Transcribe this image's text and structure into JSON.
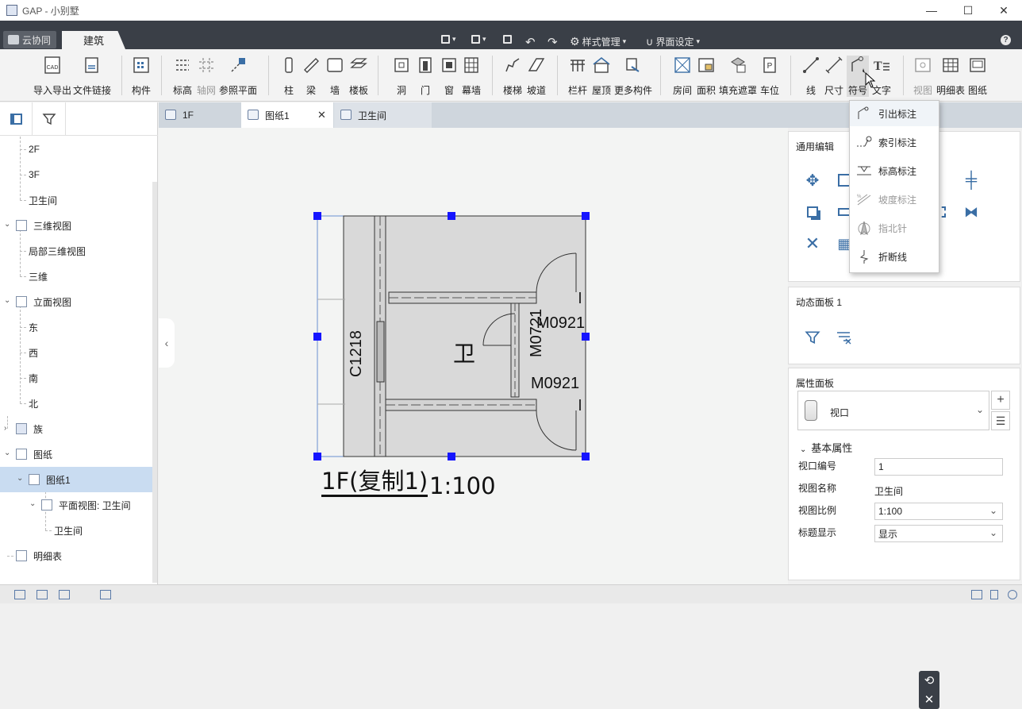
{
  "window": {
    "title": "GAP - 小别墅",
    "minimize": "—",
    "maximize": "☐",
    "close": "✕"
  },
  "top_tabs": {
    "cloud": "云协同",
    "building": "建筑"
  },
  "quick_access": {
    "style_manage": "样式管理",
    "ui_settings": "界面设定",
    "help": "?"
  },
  "ribbon": {
    "import_export": "导入导出",
    "file_link": "文件链接",
    "component": "构件",
    "level": "标高",
    "grid": "轴网",
    "ref_plane": "参照平面",
    "column": "柱",
    "beam": "梁",
    "wall": "墙",
    "slab": "楼板",
    "opening": "洞",
    "door": "门",
    "window": "窗",
    "curtain_wall": "幕墙",
    "stair": "楼梯",
    "ramp": "坡道",
    "railing": "栏杆",
    "roof": "屋顶",
    "more": "更多构件",
    "room": "房间",
    "area": "面积",
    "fill_mask": "填充遮罩",
    "parking": "车位",
    "line": "线",
    "dimension": "尺寸",
    "symbol": "符号",
    "text": "文字",
    "view": "视图",
    "schedule": "明细表",
    "sheet": "图纸"
  },
  "symbol_menu": [
    {
      "label": "引出标注",
      "icon": "leader-note-icon",
      "enabled": true
    },
    {
      "label": "索引标注",
      "icon": "index-note-icon",
      "enabled": true
    },
    {
      "label": "标高标注",
      "icon": "elevation-note-icon",
      "enabled": true
    },
    {
      "label": "坡度标注",
      "icon": "slope-note-icon",
      "enabled": false
    },
    {
      "label": "指北针",
      "icon": "north-arrow-icon",
      "enabled": false
    },
    {
      "label": "折断线",
      "icon": "break-line-icon",
      "enabled": true
    }
  ],
  "tree": {
    "n_2f": "2F",
    "n_3f": "3F",
    "n_bath": "卫生间",
    "n_3dviews": "三维视图",
    "n_local3d": "局部三维视图",
    "n_3d": "三维",
    "n_elev": "立面视图",
    "n_east": "东",
    "n_west": "西",
    "n_south": "南",
    "n_north": "北",
    "n_family": "族",
    "n_sheets": "图纸",
    "n_sheet1": "图纸1",
    "n_planview": "平面视图: 卫生间",
    "n_bath2": "卫生间",
    "n_schedule": "明细表"
  },
  "doc_tabs": {
    "t1": "1F",
    "t2": "图纸1",
    "t3": "卫生间",
    "close": "✕"
  },
  "drawing": {
    "c1218": "C1218",
    "m0721": "M0721",
    "m0921a": "M0921",
    "m0921b": "M0921",
    "room": "卫",
    "view_title": "1F(复制1)",
    "scale": "1:100"
  },
  "right_panel": {
    "general_edit": "通用编辑",
    "dynamic_panel": "动态面板 1",
    "property_panel": "属性面板",
    "type_selector": "视口",
    "basic_props": "基本属性",
    "props": {
      "viewport_no_label": "视口编号",
      "viewport_no": "1",
      "view_name_label": "视图名称",
      "view_name": "卫生间",
      "view_scale_label": "视图比例",
      "view_scale": "1:100",
      "title_display_label": "标题显示",
      "title_display": "显示"
    }
  },
  "colors": {
    "accent": "#3a6ea5",
    "handle": "#1515ff",
    "tabbar": "#3a3f47"
  }
}
